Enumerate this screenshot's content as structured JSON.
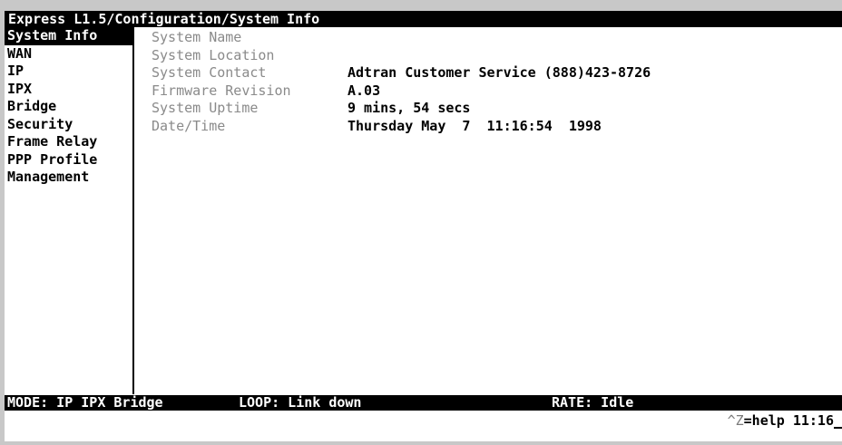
{
  "title": "Express L1.5/Configuration/System Info",
  "sidebar": {
    "items": [
      {
        "label": "System Info"
      },
      {
        "label": "WAN"
      },
      {
        "label": "IP"
      },
      {
        "label": "IPX"
      },
      {
        "label": "Bridge"
      },
      {
        "label": "Security"
      },
      {
        "label": "Frame Relay"
      },
      {
        "label": "PPP Profile"
      },
      {
        "label": "Management"
      }
    ]
  },
  "fields": [
    {
      "label": "System Name",
      "value": ""
    },
    {
      "label": "System Location",
      "value": ""
    },
    {
      "label": "System Contact",
      "value": "Adtran Customer Service (888)423-8726"
    },
    {
      "label": "Firmware Revision",
      "value": "A.03"
    },
    {
      "label": "System Uptime",
      "value": "9 mins, 54 secs"
    },
    {
      "label": "Date/Time",
      "value": "Thursday May  7  11:16:54  1998"
    }
  ],
  "status": {
    "mode": "MODE: IP IPX Bridge",
    "loop": "LOOP: Link down",
    "rate": "RATE: Idle"
  },
  "help": {
    "key": "^Z",
    "text": "=help",
    "time": "11:16"
  },
  "colors": {
    "background": "#ffffff",
    "inverse": "#000000",
    "label_gray": "#8a8a8a",
    "frame_gray": "#c8c8c8"
  }
}
